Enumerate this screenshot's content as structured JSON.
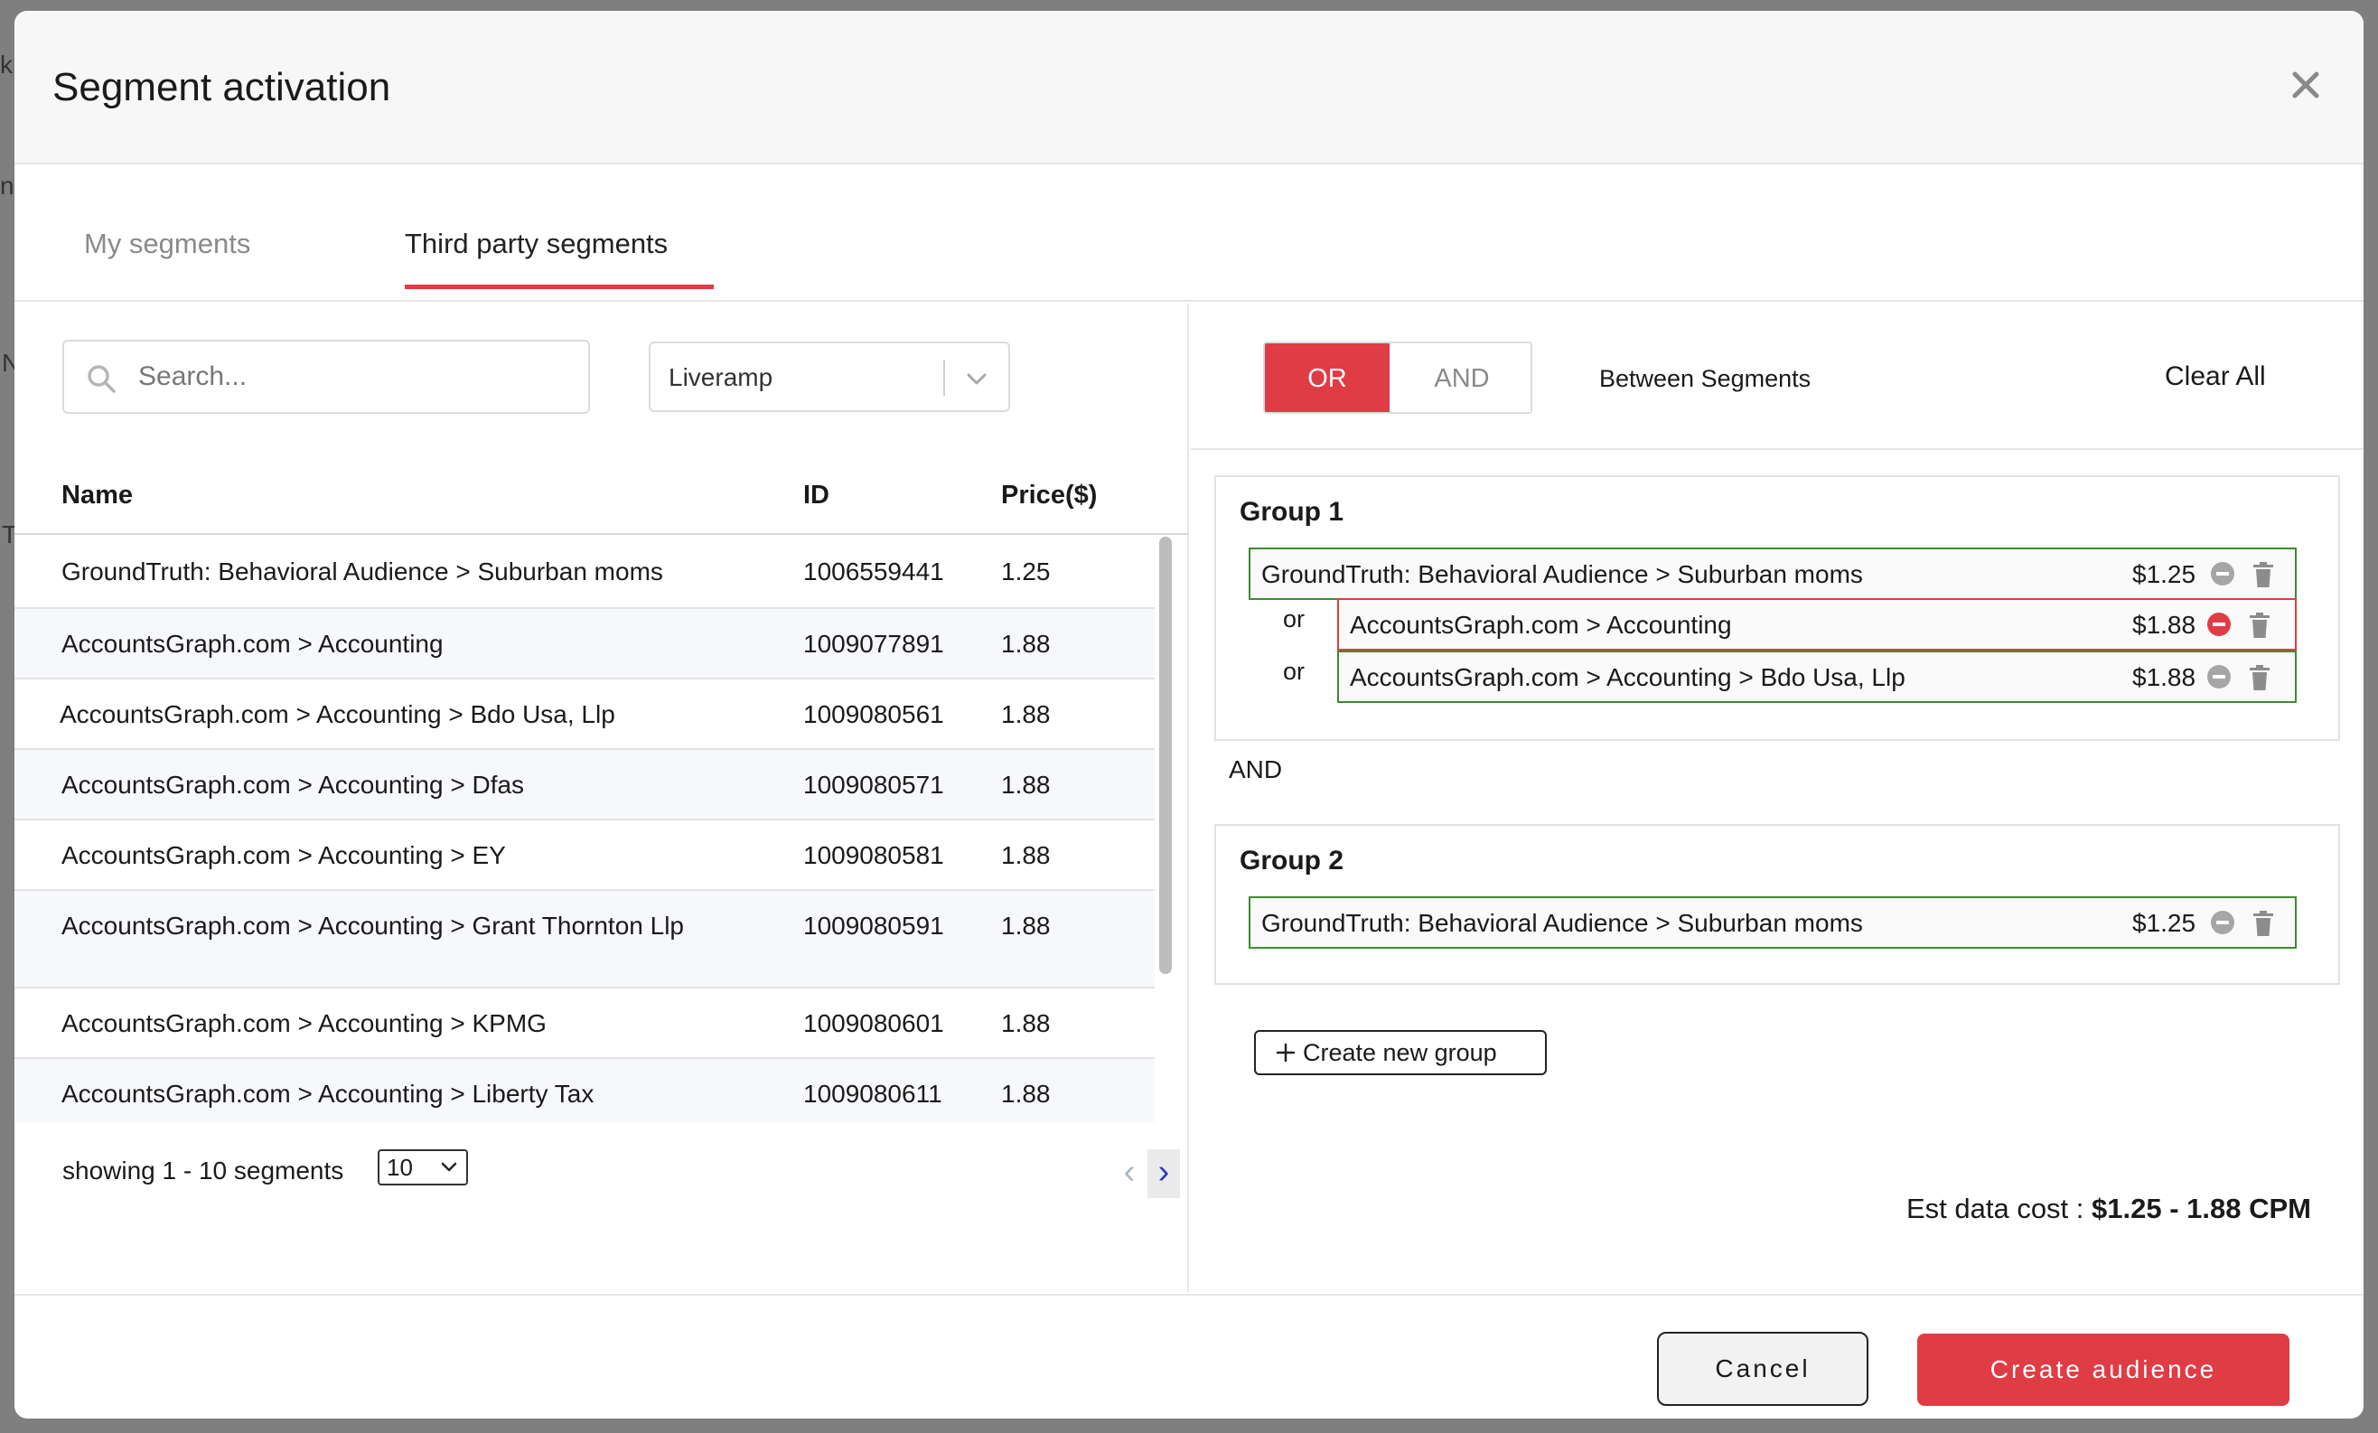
{
  "background": {
    "fragments": [
      "k",
      "n",
      "N",
      "T"
    ]
  },
  "modal": {
    "title": "Segment activation"
  },
  "tabs": [
    {
      "label": "My segments",
      "active": false
    },
    {
      "label": "Third party segments",
      "active": true
    }
  ],
  "search": {
    "placeholder": "Search...",
    "value": ""
  },
  "provider": {
    "selected": "Liveramp"
  },
  "table": {
    "headers": {
      "name": "Name",
      "id": "ID",
      "price": "Price($)"
    },
    "rows": [
      {
        "name": "GroundTruth: Behavioral Audience > Suburban moms",
        "id": "1006559441",
        "price": "1.25"
      },
      {
        "name": "AccountsGraph.com > Accounting",
        "id": "1009077891",
        "price": "1.88"
      },
      {
        "name": "AccountsGraph.com > Accounting > Bdo Usa, Llp",
        "id": "1009080561",
        "price": "1.88"
      },
      {
        "name": "AccountsGraph.com > Accounting > Dfas",
        "id": "1009080571",
        "price": "1.88"
      },
      {
        "name": "AccountsGraph.com > Accounting > EY",
        "id": "1009080581",
        "price": "1.88"
      },
      {
        "name": "AccountsGraph.com > Accounting > Grant Thornton Llp",
        "id": "1009080591",
        "price": "1.88"
      },
      {
        "name": "AccountsGraph.com > Accounting > KPMG",
        "id": "1009080601",
        "price": "1.88"
      },
      {
        "name": "AccountsGraph.com > Accounting > Liberty Tax",
        "id": "1009080611",
        "price": "1.88"
      }
    ]
  },
  "pagination": {
    "showing": "showing 1 - 10 segments",
    "page_size": "10",
    "prev": "‹",
    "next": "›"
  },
  "logic": {
    "or_label": "OR",
    "and_label": "AND",
    "selected": "OR",
    "between_label": "Between Segments",
    "clear_all": "Clear All"
  },
  "groups": [
    {
      "title": "Group 1",
      "segments": [
        {
          "name": "GroundTruth: Behavioral Audience > Suburban moms",
          "price": "$1.25",
          "state": "valid"
        },
        {
          "connector": "or",
          "name": "AccountsGraph.com > Accounting",
          "price": "$1.88",
          "state": "error"
        },
        {
          "connector": "or",
          "name": "AccountsGraph.com > Accounting > Bdo Usa, Llp",
          "price": "$1.88",
          "state": "valid"
        }
      ]
    },
    {
      "title": "Group 2",
      "segments": [
        {
          "name": "GroundTruth: Behavioral Audience > Suburban moms",
          "price": "$1.25",
          "state": "valid"
        }
      ]
    }
  ],
  "groups_connector": "AND",
  "create_group_label": "Create new group",
  "est_cost": {
    "label": "Est data cost :",
    "value": "$1.25 - 1.88 CPM"
  },
  "footer": {
    "cancel": "Cancel",
    "create": "Create audience"
  },
  "colors": {
    "accent": "#e03c45",
    "valid_border": "#3d8c2e",
    "error_border": "#e03c45"
  }
}
